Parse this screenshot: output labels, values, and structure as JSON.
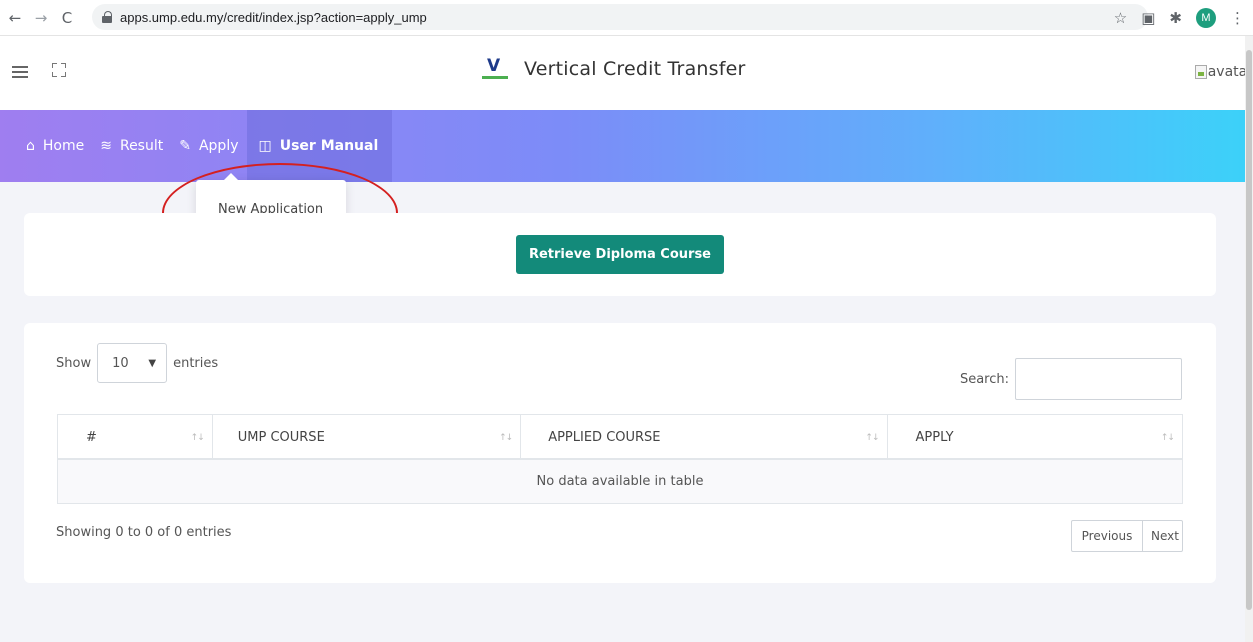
{
  "browser": {
    "url": "apps.ump.edu.my/credit/index.jsp?action=apply_ump",
    "profile_initial": "M"
  },
  "header": {
    "title": "Vertical Credit Transfer",
    "logo_letter": "V",
    "avatar_alt": "avatar"
  },
  "nav": {
    "items": [
      {
        "label": "Home",
        "icon": "home-icon"
      },
      {
        "label": "Result",
        "icon": "layers-icon"
      },
      {
        "label": "Apply",
        "icon": "edit-icon"
      },
      {
        "label": "User Manual",
        "icon": "book-icon"
      }
    ],
    "apply_dropdown": {
      "item": "New Application"
    },
    "gradient": [
      "#9f7ef0",
      "#3bd2f9"
    ]
  },
  "actions": {
    "retrieve_label": "Retrieve Diploma Course",
    "retrieve_color": "#138a7a"
  },
  "table_controls": {
    "show_label": "Show",
    "entries_value": "10",
    "entries_label": "entries",
    "search_label": "Search:",
    "search_value": ""
  },
  "table": {
    "columns": [
      "#",
      "UMP COURSE",
      "APPLIED COURSE",
      "APPLY"
    ],
    "empty_message": "No data available in table"
  },
  "footer": {
    "info": "Showing 0 to 0 of 0 entries",
    "previous_label": "Previous",
    "next_label": "Next"
  },
  "annotation_color": "#d42020"
}
